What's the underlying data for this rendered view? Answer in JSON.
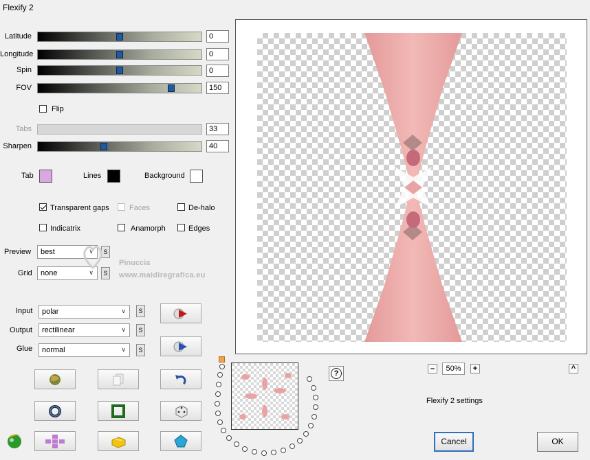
{
  "window": {
    "title": "Flexify 2"
  },
  "sliders": [
    {
      "label": "Latitude",
      "value": "0",
      "fraction": 0.5,
      "enabled": true
    },
    {
      "label": "Longitude",
      "value": "0",
      "fraction": 0.5,
      "enabled": true
    },
    {
      "label": "Spin",
      "value": "0",
      "fraction": 0.5,
      "enabled": true
    },
    {
      "label": "FOV",
      "value": "150",
      "fraction": 0.83,
      "enabled": true
    },
    {
      "label": "Tabs",
      "value": "33",
      "fraction": 0.0,
      "enabled": false
    },
    {
      "label": "Sharpen",
      "value": "40",
      "fraction": 0.4,
      "enabled": true
    }
  ],
  "flip": {
    "label": "Flip",
    "checked": false
  },
  "colors": {
    "tab": {
      "label": "Tab",
      "value": "#d9a8e0"
    },
    "lines": {
      "label": "Lines",
      "value": "#000000"
    },
    "background": {
      "label": "Background",
      "value": "#ffffff"
    }
  },
  "options": {
    "transparent_gaps": {
      "label": "Transparent gaps",
      "checked": true
    },
    "faces": {
      "label": "Faces",
      "checked": false
    },
    "de_halo": {
      "label": "De-halo",
      "checked": false
    },
    "indicatrix": {
      "label": "Indicatrix",
      "checked": false
    },
    "anamorph": {
      "label": "Anamorph",
      "checked": false
    },
    "edges": {
      "label": "Edges",
      "checked": false
    }
  },
  "preview_select": {
    "label": "Preview",
    "value": "best"
  },
  "grid_select": {
    "label": "Grid",
    "value": "none"
  },
  "input_select": {
    "label": "Input",
    "value": "polar"
  },
  "output_select": {
    "label": "Output",
    "value": "rectilinear"
  },
  "glue_select": {
    "label": "Glue",
    "value": "normal"
  },
  "s_label": "S",
  "watermark": {
    "line1": "Pinuccia",
    "line2": "www.maidiregrafica.eu"
  },
  "zoom": {
    "minus": "–",
    "value": "50%",
    "plus": "+"
  },
  "help_label": "?",
  "collapse_label": "^",
  "settings_name": "Flexify 2 settings",
  "buttons": {
    "cancel": "Cancel",
    "ok": "OK"
  },
  "palette": {
    "accent": "#2d6fc0",
    "image_pink": "#e9a3a3"
  }
}
